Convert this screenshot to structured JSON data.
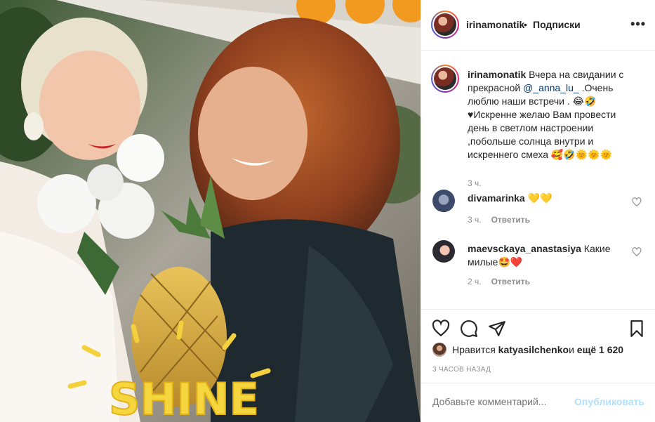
{
  "photo": {
    "sticker_text": "SHINE"
  },
  "header": {
    "username": "irinamonatik",
    "separator": "•",
    "follow_status": "Подписки",
    "more": "•••"
  },
  "caption": {
    "username": "irinamonatik",
    "text_before": " Вчера на свидании с прекрасной ",
    "mention": "@_anna_lu_",
    "text_after": " .Очень люблю наши встречи . 😂🤣 ♥Искренне желаю Вам провести день в светлом настроении ,побольше солнца внутри и искреннего смеха 🥰🤣🌞🌞🌞",
    "time": "3 ч."
  },
  "comments": [
    {
      "username": "divamarinka",
      "text": " 💛💛",
      "time": "3 ч.",
      "reply": "Ответить"
    },
    {
      "username": "maevsckaya_anastasiya",
      "text": " Какие милые🤩❤️",
      "time": "2 ч.",
      "reply": "Ответить"
    }
  ],
  "likes": {
    "prefix": "Нравится ",
    "user": "katyasilchenko",
    "middle": " и ",
    "rest": "ещё 1 620"
  },
  "timestamp": "3 ЧАСОВ НАЗАД",
  "add_comment": {
    "placeholder": "Добавьте комментарий...",
    "post_label": "Опубликовать"
  },
  "colors": {
    "link": "#00376b",
    "muted": "#8e8e8e",
    "post_disabled": "#b2dffc"
  }
}
